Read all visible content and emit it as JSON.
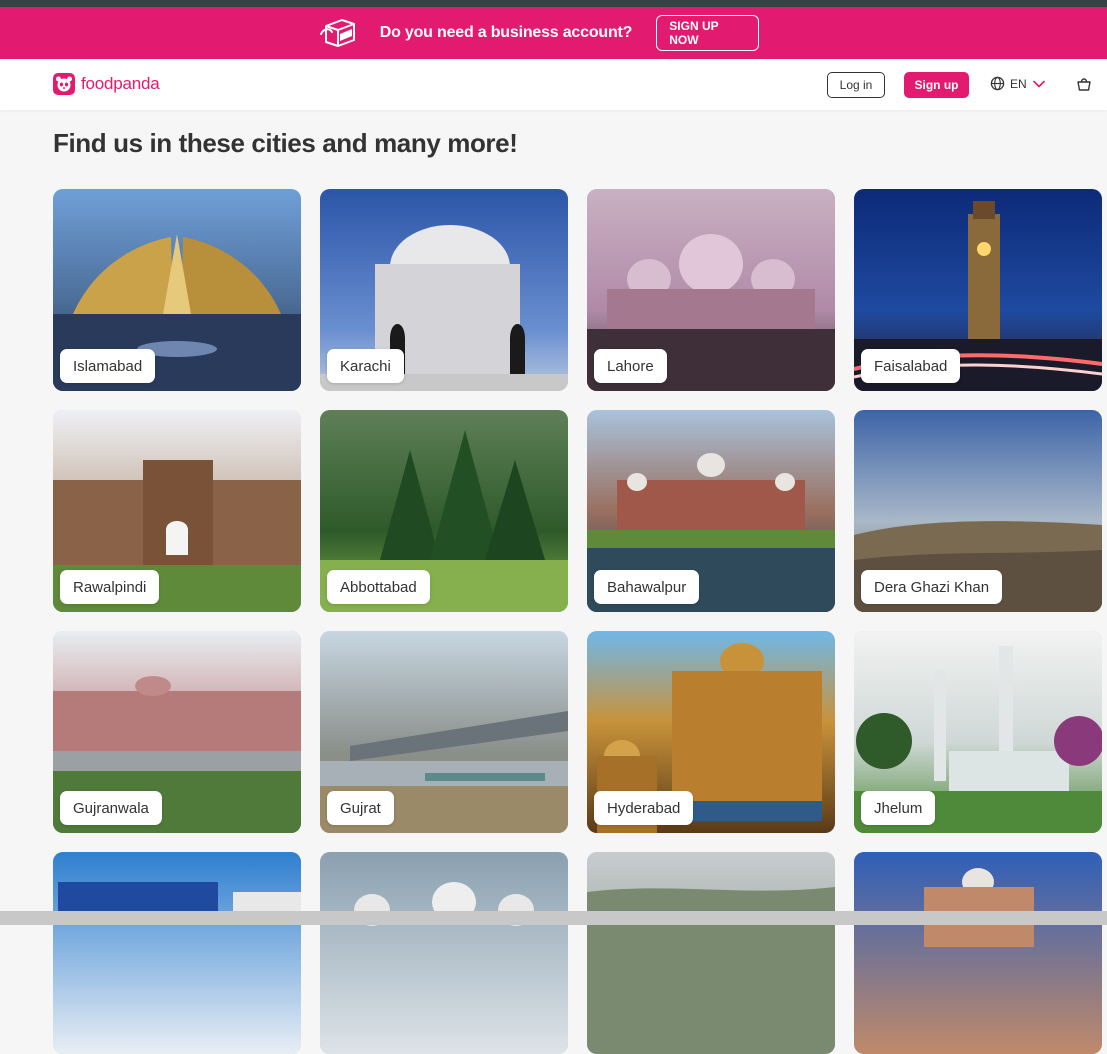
{
  "promo": {
    "message": "Do you need a business account?",
    "cta_label": "SIGN UP NOW"
  },
  "header": {
    "brand": "foodpanda",
    "login_label": "Log in",
    "signup_label": "Sign up",
    "language": "EN"
  },
  "page": {
    "title": "Find us in these cities and many more!"
  },
  "cities": [
    {
      "name": "Islamabad"
    },
    {
      "name": "Karachi"
    },
    {
      "name": "Lahore"
    },
    {
      "name": "Faisalabad"
    },
    {
      "name": "Rawalpindi"
    },
    {
      "name": "Abbottabad"
    },
    {
      "name": "Bahawalpur"
    },
    {
      "name": "Dera Ghazi Khan"
    },
    {
      "name": "Gujranwala"
    },
    {
      "name": "Gujrat"
    },
    {
      "name": "Hyderabad"
    },
    {
      "name": "Jhelum"
    },
    {
      "name": ""
    },
    {
      "name": ""
    },
    {
      "name": ""
    },
    {
      "name": ""
    }
  ],
  "colors": {
    "brand": "#e21b70",
    "top_strip": "#3b4245",
    "text": "#333333"
  }
}
